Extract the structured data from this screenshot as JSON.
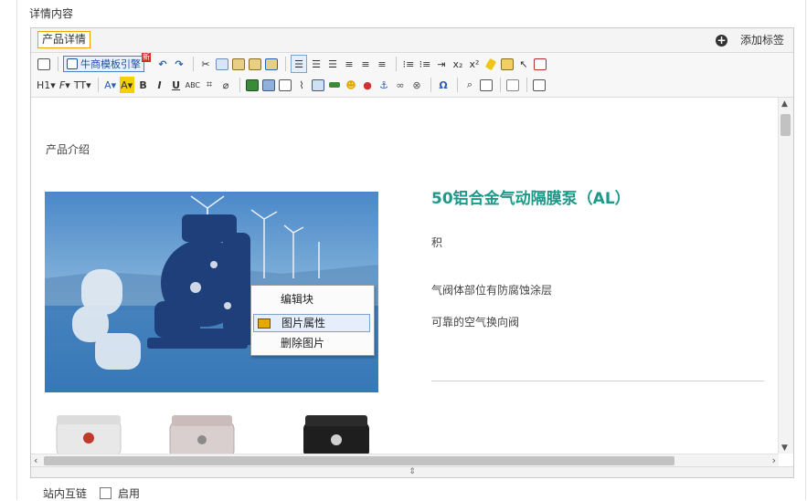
{
  "section": {
    "label": "详情内容"
  },
  "tabs": {
    "active_label": "产品详情",
    "add_label": "添加标签"
  },
  "toolbar": {
    "template_label": "牛商模板引擎",
    "template_badge": "新",
    "heading_label": "H1",
    "font_label": "F",
    "size_label": "TT",
    "omega_label": "Ω",
    "abc_label": "ABC"
  },
  "content": {
    "intro": "产品介绍",
    "title": "50铝合金气动隔膜泵（AL）",
    "p1": "积",
    "p2": "气阀体部位有防腐蚀涂层",
    "p3": "可靠的空气换向阀"
  },
  "context_menu": {
    "items": [
      "编辑块",
      "图片属性",
      "删除图片"
    ]
  },
  "footer": {
    "link_label": "站内互链",
    "enable_label": "启用"
  }
}
